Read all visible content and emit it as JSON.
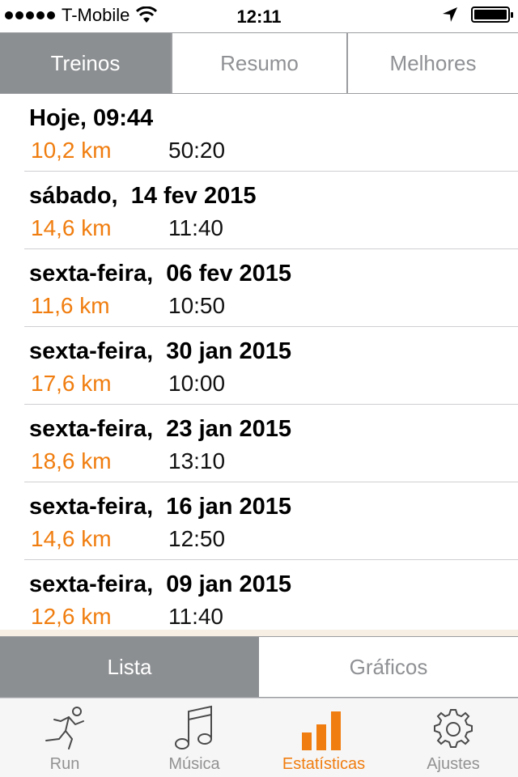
{
  "status_bar": {
    "carrier": "T-Mobile",
    "time": "12:11"
  },
  "top_segments": {
    "items": [
      "Treinos",
      "Resumo",
      "Melhores"
    ],
    "active": "Treinos"
  },
  "workouts": [
    {
      "date": "Hoje, 09:44",
      "distance": "10,2 km",
      "duration": "50:20"
    },
    {
      "date": "sábado,  14 fev 2015",
      "distance": "14,6 km",
      "duration": "11:40"
    },
    {
      "date": "sexta-feira,  06 fev 2015",
      "distance": "11,6 km",
      "duration": "10:50"
    },
    {
      "date": "sexta-feira,  30 jan 2015",
      "distance": "17,6 km",
      "duration": "10:00"
    },
    {
      "date": "sexta-feira,  23 jan 2015",
      "distance": "18,6 km",
      "duration": "13:10"
    },
    {
      "date": "sexta-feira,  16 jan 2015",
      "distance": "14,6 km",
      "duration": "12:50"
    },
    {
      "date": "sexta-feira,  09 jan 2015",
      "distance": "12,6 km",
      "duration": "11:40"
    }
  ],
  "bottom_segments": {
    "items": [
      "Lista",
      "Gráficos"
    ],
    "active": "Lista"
  },
  "tab_bar": {
    "items": [
      {
        "label": "Run",
        "icon": "runner-icon"
      },
      {
        "label": "Música",
        "icon": "music-note-icon"
      },
      {
        "label": "Estatísticas",
        "icon": "bar-chart-icon"
      },
      {
        "label": "Ajustes",
        "icon": "gear-icon"
      }
    ],
    "active": "Estatísticas"
  },
  "colors": {
    "accent": "#f07d0f",
    "segment_active_bg": "#8c8f92",
    "segment_text": "#8f9194"
  }
}
